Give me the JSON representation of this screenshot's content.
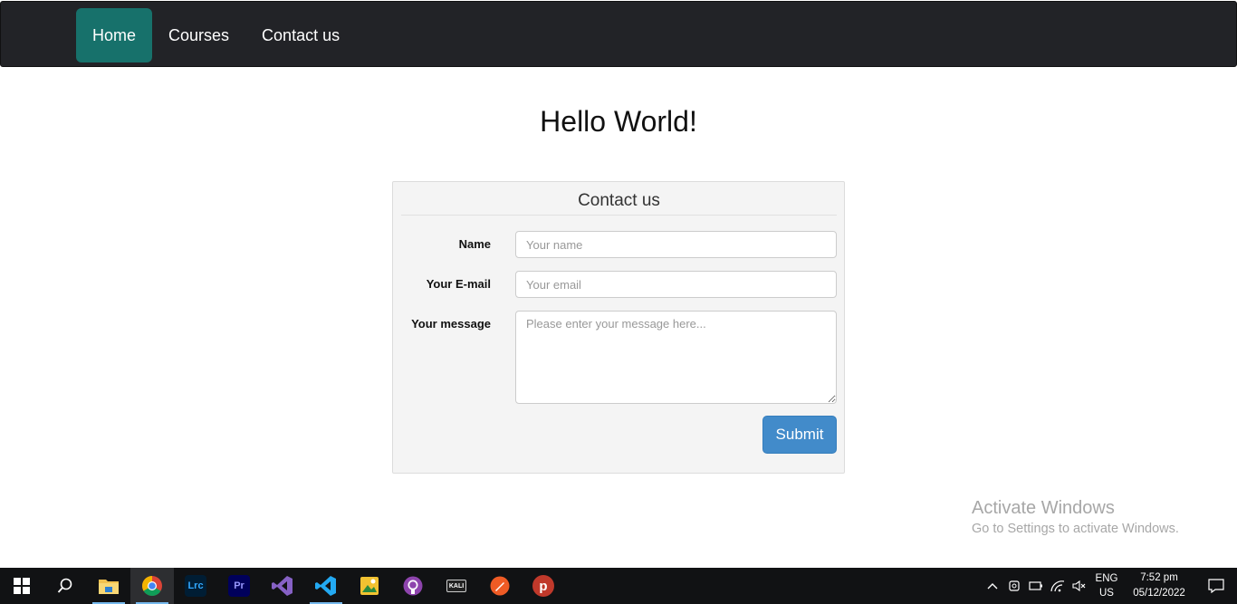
{
  "nav": {
    "items": [
      {
        "label": "Home",
        "active": true
      },
      {
        "label": "Courses",
        "active": false
      },
      {
        "label": "Contact us",
        "active": false
      }
    ]
  },
  "page": {
    "title": "Hello World!"
  },
  "contact_form": {
    "title": "Contact us",
    "name_label": "Name",
    "name_placeholder": "Your name",
    "email_label": "Your E-mail",
    "email_placeholder": "Your email",
    "message_label": "Your message",
    "message_placeholder": "Please enter your message here...",
    "submit_label": "Submit"
  },
  "watermark": {
    "title": "Activate Windows",
    "subtitle": "Go to Settings to activate Windows."
  },
  "taskbar": {
    "apps": [
      {
        "icon": "windows-start-icon"
      },
      {
        "icon": "search-icon"
      },
      {
        "icon": "file-explorer-icon",
        "label": ""
      },
      {
        "icon": "chrome-icon"
      },
      {
        "icon": "lightroom-icon",
        "label": "Lrc"
      },
      {
        "icon": "premiere-icon",
        "label": "Pr"
      },
      {
        "icon": "visual-studio-icon"
      },
      {
        "icon": "vscode-icon"
      },
      {
        "icon": "photo-app-icon"
      },
      {
        "icon": "github-icon"
      },
      {
        "icon": "kali-icon",
        "label": "KALI"
      },
      {
        "icon": "postman-icon"
      },
      {
        "icon": "psiphon-icon",
        "label": "p"
      }
    ],
    "language": {
      "line1": "ENG",
      "line2": "US"
    },
    "clock": {
      "time": "7:52 pm",
      "date": "05/12/2022"
    }
  }
}
